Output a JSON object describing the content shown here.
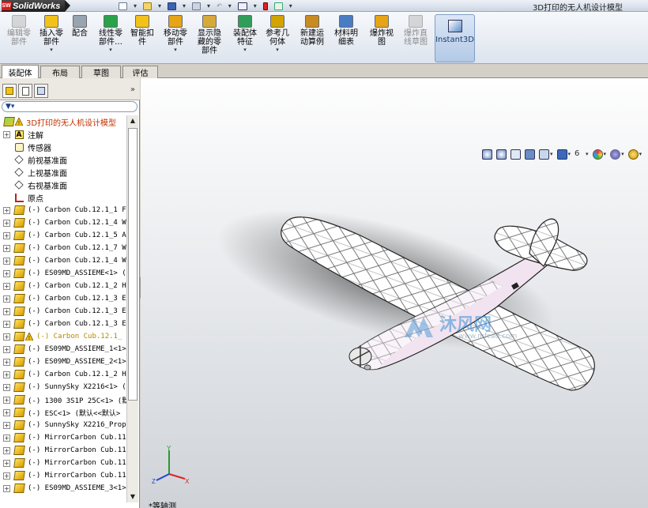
{
  "app": {
    "name": "SolidWorks",
    "document_title": "3D打印的无人机设计模型"
  },
  "ribbon": {
    "buttons": [
      {
        "label": "编辑零\n部件",
        "disabled": true,
        "dropdown": false
      },
      {
        "label": "插入零\n部件",
        "disabled": false,
        "dropdown": true
      },
      {
        "label": "配合",
        "disabled": false,
        "dropdown": false
      },
      {
        "label": "线性零\n部件…",
        "disabled": false,
        "dropdown": true
      },
      {
        "label": "智能扣\n件",
        "disabled": false,
        "dropdown": false
      },
      {
        "label": "移动零\n部件",
        "disabled": false,
        "dropdown": true
      },
      {
        "label": "显示隐\n藏的零\n部件",
        "disabled": false,
        "dropdown": false
      },
      {
        "label": "装配体\n特征",
        "disabled": false,
        "dropdown": true
      },
      {
        "label": "参考几\n何体",
        "disabled": false,
        "dropdown": true
      },
      {
        "label": "新建运\n动算例",
        "disabled": false,
        "dropdown": false
      },
      {
        "label": "材料明\n细表",
        "disabled": false,
        "dropdown": false
      },
      {
        "label": "爆炸视\n图",
        "disabled": false,
        "dropdown": false
      },
      {
        "label": "爆炸直\n线草图",
        "disabled": true,
        "dropdown": false
      }
    ],
    "instant3d": "Instant3D"
  },
  "tabs": [
    "装配体",
    "布局",
    "草图",
    "评估"
  ],
  "tree": {
    "root": "3D打印的无人机设计模型",
    "items": [
      {
        "label": "注解",
        "icon": "annotation-icon",
        "expand": true,
        "mono": false
      },
      {
        "label": "传感器",
        "icon": "sensor-icon",
        "expand": false,
        "mono": false
      },
      {
        "label": "前视基准面",
        "icon": "plane-icon",
        "expand": false,
        "mono": false
      },
      {
        "label": "上视基准面",
        "icon": "plane-icon",
        "expand": false,
        "mono": false
      },
      {
        "label": "右视基准面",
        "icon": "plane-icon",
        "expand": false,
        "mono": false
      },
      {
        "label": "原点",
        "icon": "origin-icon",
        "expand": false,
        "mono": false
      },
      {
        "label": "(-) Carbon Cub.12.1_1 F",
        "icon": "part-icon",
        "expand": true,
        "mono": true
      },
      {
        "label": "(-) Carbon Cub.12.1_4 W",
        "icon": "part-icon",
        "expand": true,
        "mono": true
      },
      {
        "label": "(-) Carbon Cub.12.1_5 A",
        "icon": "part-icon",
        "expand": true,
        "mono": true
      },
      {
        "label": "(-) Carbon Cub.12.1_7 W",
        "icon": "part-icon",
        "expand": true,
        "mono": true
      },
      {
        "label": "(-) Carbon Cub.12.1_4 W",
        "icon": "part-icon",
        "expand": true,
        "mono": true
      },
      {
        "label": "(-) ES09MD_ASSIEME<1> (",
        "icon": "part-icon",
        "expand": true,
        "mono": true
      },
      {
        "label": "(-) Carbon Cub.12.1_2 H",
        "icon": "part-icon",
        "expand": true,
        "mono": true
      },
      {
        "label": "(-) Carbon Cub.12.1_3 E",
        "icon": "part-icon",
        "expand": true,
        "mono": true
      },
      {
        "label": "(-) Carbon Cub.12.1_3 E",
        "icon": "part-icon",
        "expand": true,
        "mono": true
      },
      {
        "label": "(-) Carbon Cub.12.1_3 E",
        "icon": "part-icon",
        "expand": true,
        "mono": true
      },
      {
        "label": "(-) Carbon Cub.12.1_",
        "icon": "part-icon",
        "expand": true,
        "mono": true,
        "warn": true
      },
      {
        "label": "(-) ES09MD_ASSIEME_1<1>",
        "icon": "part-icon",
        "expand": true,
        "mono": true
      },
      {
        "label": "(-) ES09MD_ASSIEME_2<1>",
        "icon": "part-icon",
        "expand": true,
        "mono": true
      },
      {
        "label": "(-) Carbon Cub.12.1_2 H",
        "icon": "part-icon",
        "expand": true,
        "mono": true
      },
      {
        "label": "(-) SunnySky X2216<1> (",
        "icon": "part-icon",
        "expand": true,
        "mono": true
      },
      {
        "label": "(-) 1300 3S1P 25C<1> (默",
        "icon": "part-icon",
        "expand": true,
        "mono": true
      },
      {
        "label": "(-) ESC<1> (默认<<默认>",
        "icon": "part-icon",
        "expand": true,
        "mono": true
      },
      {
        "label": "(-) SunnySky X2216_Prop",
        "icon": "part-icon",
        "expand": true,
        "mono": true
      },
      {
        "label": "(-) MirrorCarbon Cub.11",
        "icon": "part-icon",
        "expand": true,
        "mono": true
      },
      {
        "label": "(-) MirrorCarbon Cub.11",
        "icon": "part-icon",
        "expand": true,
        "mono": true
      },
      {
        "label": "(-) MirrorCarbon Cub.11",
        "icon": "part-icon",
        "expand": true,
        "mono": true
      },
      {
        "label": "(-) MirrorCarbon Cub.11",
        "icon": "part-icon",
        "expand": true,
        "mono": true
      },
      {
        "label": "(-) ES09MD_ASSIEME_3<1>",
        "icon": "part-icon",
        "expand": true,
        "mono": true
      }
    ]
  },
  "view": {
    "name": "*等轴测"
  },
  "watermark": {
    "text": "沐风网",
    "url": "www.mfcad.com"
  },
  "colors": {
    "accent": "#7f9dc4",
    "part_yellow": "#f2c21b",
    "warning": "#f5c400"
  }
}
